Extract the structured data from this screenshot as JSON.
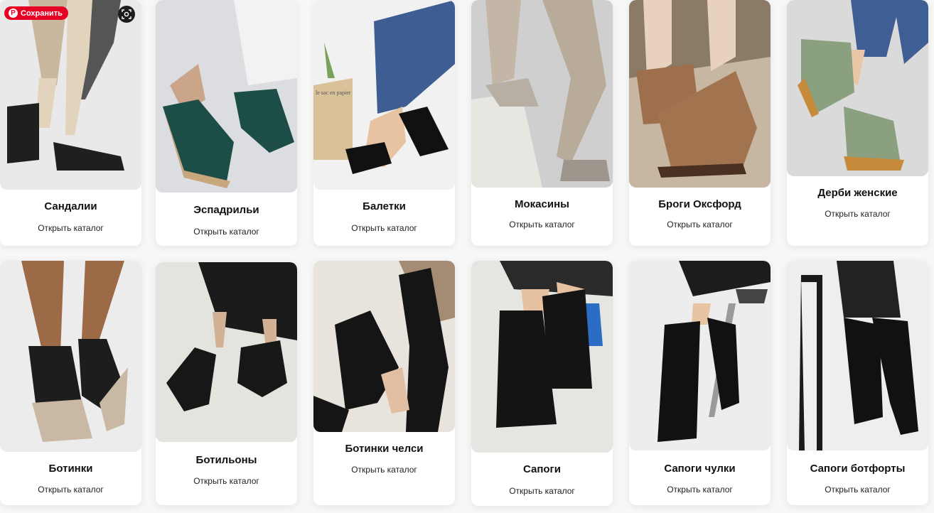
{
  "pin_button": {
    "label": "Сохранить",
    "icon": "pinterest-icon"
  },
  "visual_search": {
    "icon": "visual-search-icon"
  },
  "cards": [
    {
      "title": "Сандалии",
      "link": "Открыть каталог"
    },
    {
      "title": "Эспадрильи",
      "link": "Открыть каталог"
    },
    {
      "title": "Балетки",
      "link": "Открыть каталог"
    },
    {
      "title": "Мокасины",
      "link": "Открыть каталог"
    },
    {
      "title": "Броги Оксфорд",
      "link": "Открыть каталог"
    },
    {
      "title": "Дерби женские",
      "link": "Открыть каталог"
    },
    {
      "title": "Ботинки",
      "link": "Открыть каталог"
    },
    {
      "title": "Ботильоны",
      "link": "Открыть каталог"
    },
    {
      "title": "Ботинки челси",
      "link": "Открыть каталог"
    },
    {
      "title": "Сапоги",
      "link": "Открыть каталог"
    },
    {
      "title": "Сапоги чулки",
      "link": "Открыть каталог"
    },
    {
      "title": "Сапоги ботфорты",
      "link": "Открыть каталог"
    }
  ],
  "photo_texts": {
    "basket_label": "le sac en papier"
  }
}
